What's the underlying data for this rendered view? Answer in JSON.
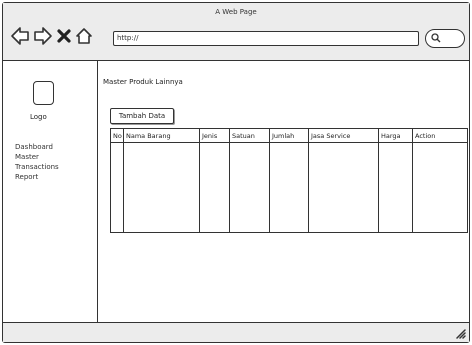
{
  "window": {
    "title": "A Web Page"
  },
  "browser": {
    "url": "http://"
  },
  "sidebar": {
    "logo_label": "Logo",
    "items": [
      {
        "label": "Dashboard"
      },
      {
        "label": "Master"
      },
      {
        "label": "Transactions"
      },
      {
        "label": "Report"
      }
    ]
  },
  "main": {
    "title": "Master Produk Lainnya",
    "add_button": "Tambah Data",
    "table": {
      "headers": [
        "No",
        "Nama Barang",
        "Jenis",
        "Satuan",
        "Jumlah",
        "Jasa Service",
        "Harga",
        "Action"
      ],
      "rows": [
        [],
        [],
        [],
        [],
        [],
        [],
        []
      ]
    }
  },
  "icons": [
    "back-arrow-icon",
    "forward-arrow-icon",
    "close-icon",
    "home-icon",
    "search-icon",
    "resize-grip-icon"
  ]
}
